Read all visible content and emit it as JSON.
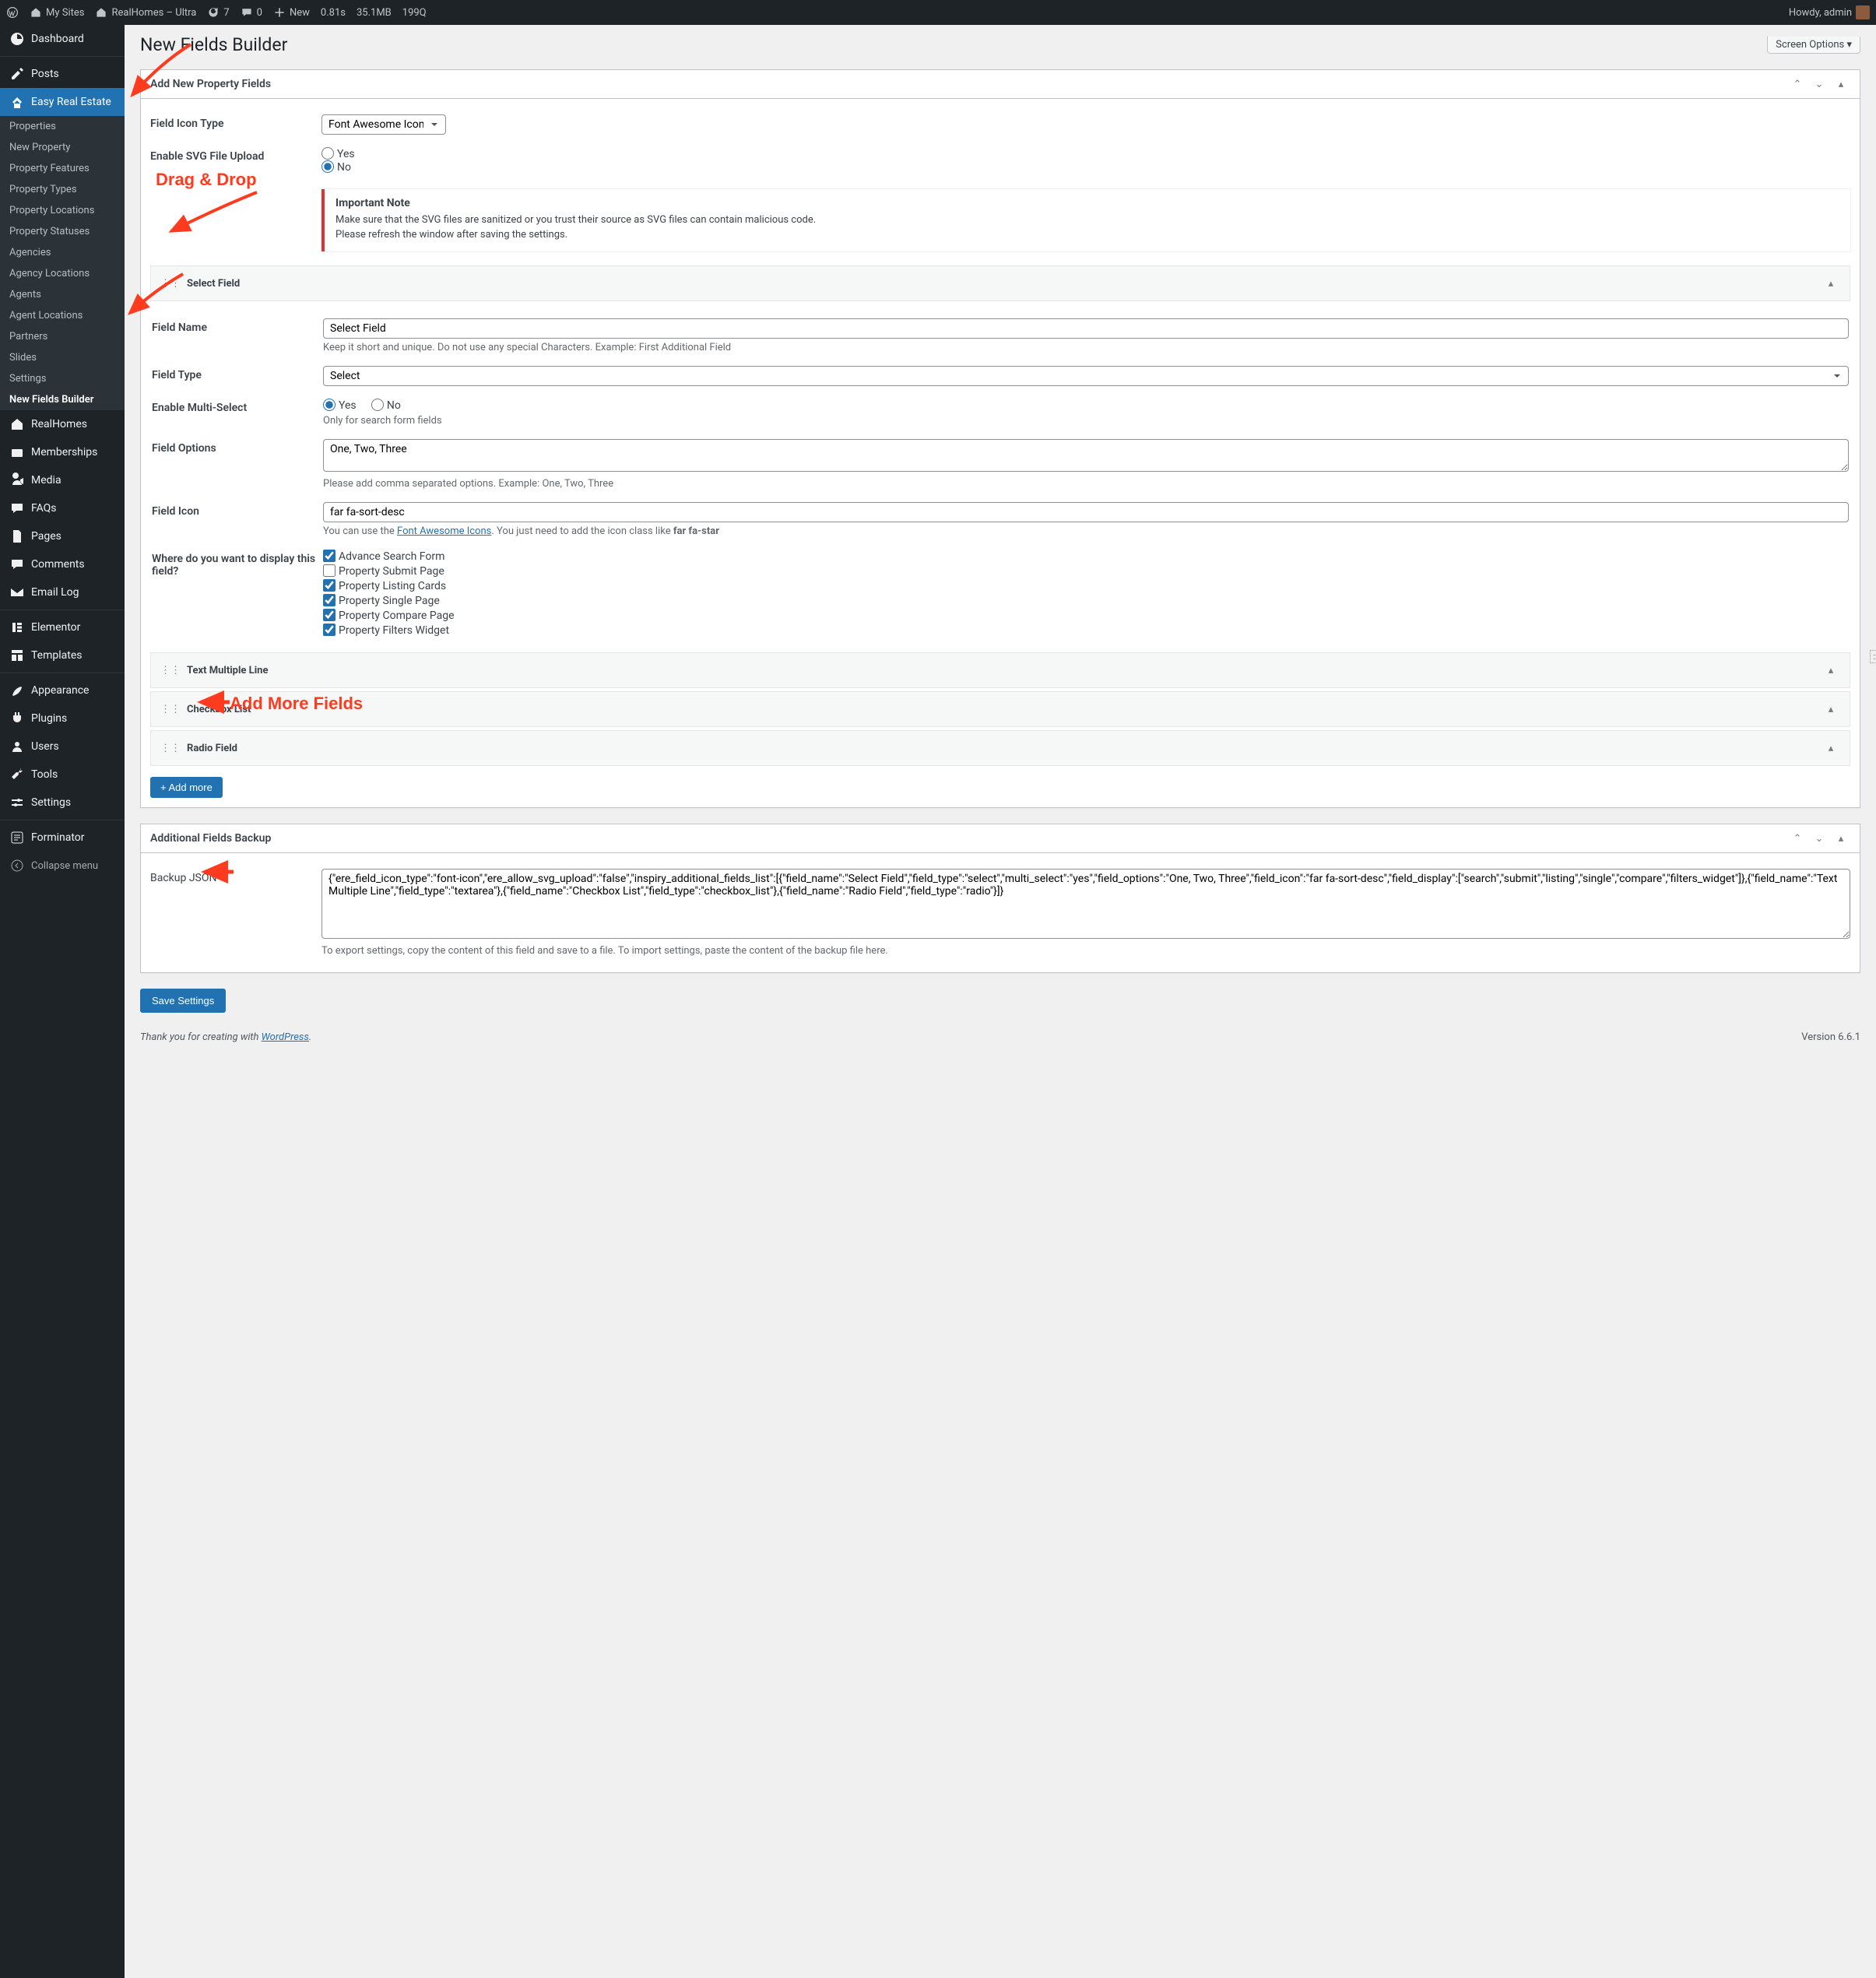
{
  "adminbar": {
    "mysites": "My Sites",
    "sitename": "RealHomes – Ultra",
    "updates": "7",
    "comments": "0",
    "new": "New",
    "timing": "0.81s",
    "memory": "35.1MB",
    "queries": "199Q",
    "howdy": "Howdy, admin"
  },
  "sidebar": {
    "dashboard": "Dashboard",
    "posts": "Posts",
    "ere": "Easy Real Estate",
    "ere_sub": [
      "Properties",
      "New Property",
      "Property Features",
      "Property Types",
      "Property Locations",
      "Property Statuses",
      "Agencies",
      "Agency Locations",
      "Agents",
      "Agent Locations",
      "Partners",
      "Slides",
      "Settings",
      "New Fields Builder"
    ],
    "realhomes": "RealHomes",
    "memberships": "Memberships",
    "media": "Media",
    "faqs": "FAQs",
    "pages": "Pages",
    "comments": "Comments",
    "emaillog": "Email Log",
    "elementor": "Elementor",
    "templates": "Templates",
    "appearance": "Appearance",
    "plugins": "Plugins",
    "users": "Users",
    "tools": "Tools",
    "settings": "Settings",
    "forminator": "Forminator",
    "collapse": "Collapse menu"
  },
  "page": {
    "title": "New Fields Builder",
    "screen_options": "Screen Options"
  },
  "box1": {
    "title": "Add New Property Fields",
    "icon_type_label": "Field Icon Type",
    "icon_type_value": "Font Awesome Icons",
    "svg_label": "Enable SVG File Upload",
    "yes": "Yes",
    "no": "No",
    "note_title": "Important Note",
    "note_line1": "Make sure that the SVG files are sanitized or you trust their source as SVG files can contain malicious code.",
    "note_line2": "Please refresh the window after saving the settings."
  },
  "field1": {
    "bar_title": "Select Field",
    "name_label": "Field Name",
    "name_value": "Select Field",
    "name_help": "Keep it short and unique. Do not use any special Characters. Example: First Additional Field",
    "type_label": "Field Type",
    "type_value": "Select",
    "multi_label": "Enable Multi-Select",
    "multi_help": "Only for search form fields",
    "options_label": "Field Options",
    "options_value": "One, Two, Three",
    "options_help": "Please add comma separated options. Example: One, Two, Three",
    "icon_label": "Field Icon",
    "icon_value": "far fa-sort-desc",
    "icon_help_pre": "You can use the ",
    "icon_help_link": "Font Awesome Icons",
    "icon_help_post": ". You just need to add the icon class like ",
    "icon_help_bold": "far fa-star",
    "display_label": "Where do you want to display this field?",
    "display_opts": [
      "Advance Search Form",
      "Property Submit Page",
      "Property Listing Cards",
      "Property Single Page",
      "Property Compare Page",
      "Property Filters Widget"
    ]
  },
  "collapsed": [
    "Text Multiple Line",
    "Checkbox List",
    "Radio Field"
  ],
  "addmore": "+ Add more",
  "box2": {
    "title": "Additional Fields Backup",
    "json_label": "Backup JSON",
    "json_value": "{\"ere_field_icon_type\":\"font-icon\",\"ere_allow_svg_upload\":\"false\",\"inspiry_additional_fields_list\":[{\"field_name\":\"Select Field\",\"field_type\":\"select\",\"multi_select\":\"yes\",\"field_options\":\"One, Two, Three\",\"field_icon\":\"far fa-sort-desc\",\"field_display\":[\"search\",\"submit\",\"listing\",\"single\",\"compare\",\"filters_widget\"]},{\"field_name\":\"Text Multiple Line\",\"field_type\":\"textarea\"},{\"field_name\":\"Checkbox List\",\"field_type\":\"checkbox_list\"},{\"field_name\":\"Radio Field\",\"field_type\":\"radio\"}]}",
    "help": "To export settings, copy the content of this field and save to a file. To import settings, paste the content of the backup file here."
  },
  "save": "Save Settings",
  "footer": {
    "thanks_pre": "Thank you for creating with ",
    "thanks_link": "WordPress",
    "version": "Version 6.6.1"
  },
  "anno": {
    "dragdrop": "Drag & Drop",
    "addmore": "Add More Fields",
    "hint": "::1"
  }
}
